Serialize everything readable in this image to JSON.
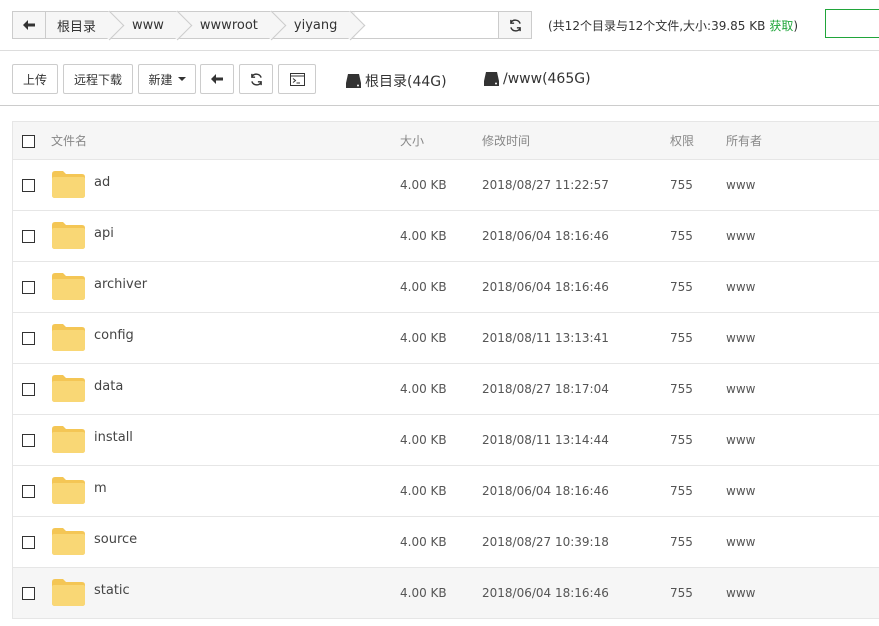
{
  "pathbar": {
    "crumbs": [
      "根目录",
      "www",
      "wwwroot",
      "yiyang"
    ]
  },
  "summary": {
    "text": "(共12个目录与12个文件,大小:39.85 KB",
    "fetch": "获取",
    "close": ")"
  },
  "toolbar": {
    "upload": "上传",
    "remote_download": "远程下载",
    "new": "新建",
    "disks": [
      {
        "label": "根目录(44G)"
      },
      {
        "label": "/www(465G)"
      }
    ]
  },
  "table": {
    "headers": {
      "name": "文件名",
      "size": "大小",
      "mtime": "修改时间",
      "perm": "权限",
      "owner": "所有者"
    },
    "rows": [
      {
        "name": "ad",
        "size": "4.00 KB",
        "mtime": "2018/08/27 11:22:57",
        "perm": "755",
        "owner": "www"
      },
      {
        "name": "api",
        "size": "4.00 KB",
        "mtime": "2018/06/04 18:16:46",
        "perm": "755",
        "owner": "www"
      },
      {
        "name": "archiver",
        "size": "4.00 KB",
        "mtime": "2018/06/04 18:16:46",
        "perm": "755",
        "owner": "www"
      },
      {
        "name": "config",
        "size": "4.00 KB",
        "mtime": "2018/08/11 13:13:41",
        "perm": "755",
        "owner": "www"
      },
      {
        "name": "data",
        "size": "4.00 KB",
        "mtime": "2018/08/27 18:17:04",
        "perm": "755",
        "owner": "www"
      },
      {
        "name": "install",
        "size": "4.00 KB",
        "mtime": "2018/08/11 13:14:44",
        "perm": "755",
        "owner": "www"
      },
      {
        "name": "m",
        "size": "4.00 KB",
        "mtime": "2018/06/04 18:16:46",
        "perm": "755",
        "owner": "www"
      },
      {
        "name": "source",
        "size": "4.00 KB",
        "mtime": "2018/08/27 10:39:18",
        "perm": "755",
        "owner": "www"
      },
      {
        "name": "static",
        "size": "4.00 KB",
        "mtime": "2018/06/04 18:16:46",
        "perm": "755",
        "owner": "www"
      }
    ]
  },
  "colors": {
    "accent": "#20a53a",
    "folder": "#f9d775",
    "folder_tab": "#f4c655"
  },
  "icons": {
    "back": "arrow-left-icon",
    "refresh": "refresh-icon",
    "terminal": "terminal-icon",
    "disk": "hard-drive-icon",
    "folder": "folder-icon"
  }
}
